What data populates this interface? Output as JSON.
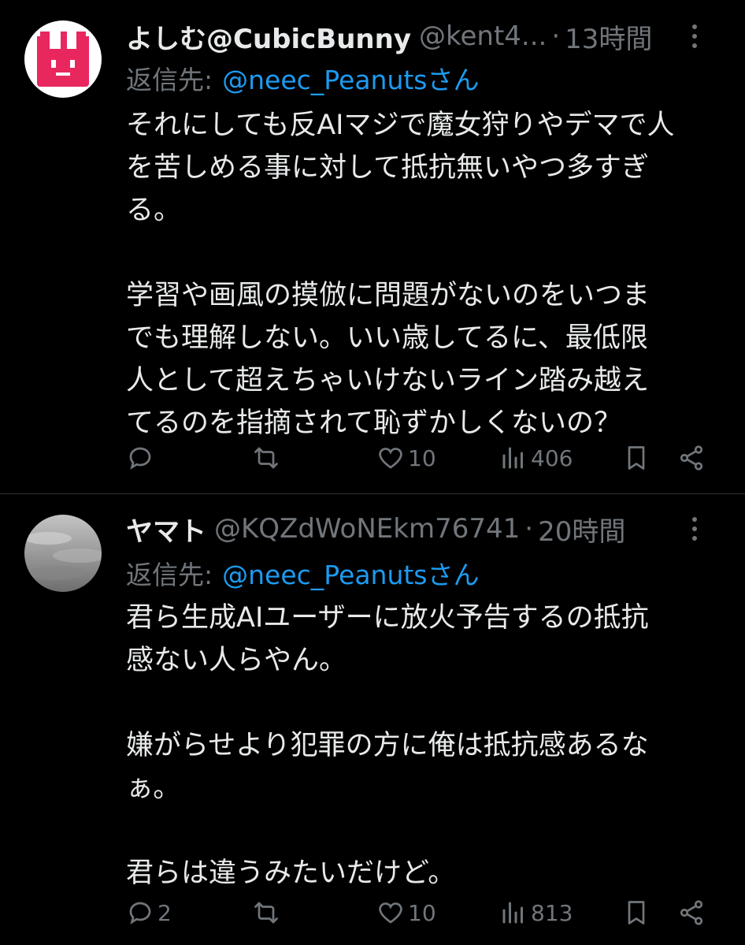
{
  "tweets": [
    {
      "display_name": "よしむ@CubicBunny",
      "handle": "@kent4...",
      "separator": "·",
      "time": "13時間",
      "reply_prefix": "返信先:",
      "reply_target": "@neec_Peanutsさん",
      "body": "それにしても反AIマジで魔女狩りやデマで人\nを苦しめる事に対して抵抗無いやつ多すぎ\nる。\n\n学習や画風の摸倣に問題がないのをいつま\nでも理解しない。いい歳してるに、最低限\n人として超えちゃいけないライン踏み越え\nてるのを指摘されて恥ずかしくないの？",
      "reply_count": "",
      "retweet_count": "",
      "like_count": "10",
      "view_count": "406",
      "avatar_color": "#e8275f"
    },
    {
      "display_name": "ヤマト",
      "handle": "@KQZdWoNEkm76741",
      "separator": "·",
      "time": "20時間",
      "reply_prefix": "返信先:",
      "reply_target": "@neec_Peanutsさん",
      "body": "君ら生成AIユーザーに放火予告するの抵抗\n感ない人らやん。\n\n嫌がらせより犯罪の方に俺は抵抗感あるな\nぁ。\n\n君らは違うみたいだけど。",
      "reply_count": "2",
      "retweet_count": "",
      "like_count": "10",
      "view_count": "813",
      "avatar_color": "#8a8a8a"
    }
  ],
  "icons": {
    "more": "more-dots-icon",
    "reply": "reply-bubble-icon",
    "retweet": "retweet-icon",
    "like": "heart-icon",
    "views": "views-bar-chart-icon",
    "bookmark": "bookmark-icon",
    "share": "share-icon"
  },
  "colors": {
    "background": "#000000",
    "text": "#e7e9ea",
    "muted": "#71767b",
    "link": "#1d9bf0",
    "divider": "#2f3336"
  }
}
